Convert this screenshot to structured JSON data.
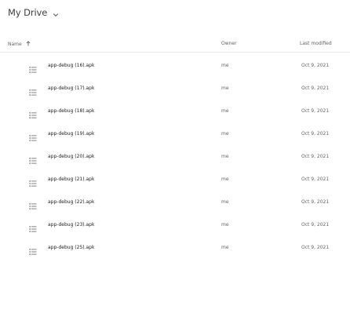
{
  "header": {
    "title": "My Drive",
    "dropdown_icon": "chevron-down-icon"
  },
  "columns": {
    "name": "Name",
    "name_sort_icon": "arrow-up-icon",
    "owner": "Owner",
    "last_modified": "Last modified"
  },
  "files": [
    {
      "name": "app-debug (16).apk",
      "owner": "me",
      "modified": "Oct 9, 2021",
      "icon": "file-list-icon"
    },
    {
      "name": "app-debug (17).apk",
      "owner": "me",
      "modified": "Oct 9, 2021",
      "icon": "file-list-icon"
    },
    {
      "name": "app-debug (18).apk",
      "owner": "me",
      "modified": "Oct 9, 2021",
      "icon": "file-list-icon"
    },
    {
      "name": "app-debug (19).apk",
      "owner": "me",
      "modified": "Oct 9, 2021",
      "icon": "file-list-icon"
    },
    {
      "name": "app-debug (20).apk",
      "owner": "me",
      "modified": "Oct 9, 2021",
      "icon": "file-list-icon"
    },
    {
      "name": "app-debug (21).apk",
      "owner": "me",
      "modified": "Oct 9, 2021",
      "icon": "file-list-icon"
    },
    {
      "name": "app-debug (22).apk",
      "owner": "me",
      "modified": "Oct 9, 2021",
      "icon": "file-list-icon"
    },
    {
      "name": "app-debug (23).apk",
      "owner": "me",
      "modified": "Oct 9, 2021",
      "icon": "file-list-icon"
    },
    {
      "name": "app-debug (25).apk",
      "owner": "me",
      "modified": "Oct 9, 2021",
      "icon": "file-list-icon"
    }
  ],
  "colors": {
    "text_primary": "#202124",
    "text_secondary": "#5f6368",
    "divider": "#e8eaed",
    "icon": "#5f6368"
  }
}
